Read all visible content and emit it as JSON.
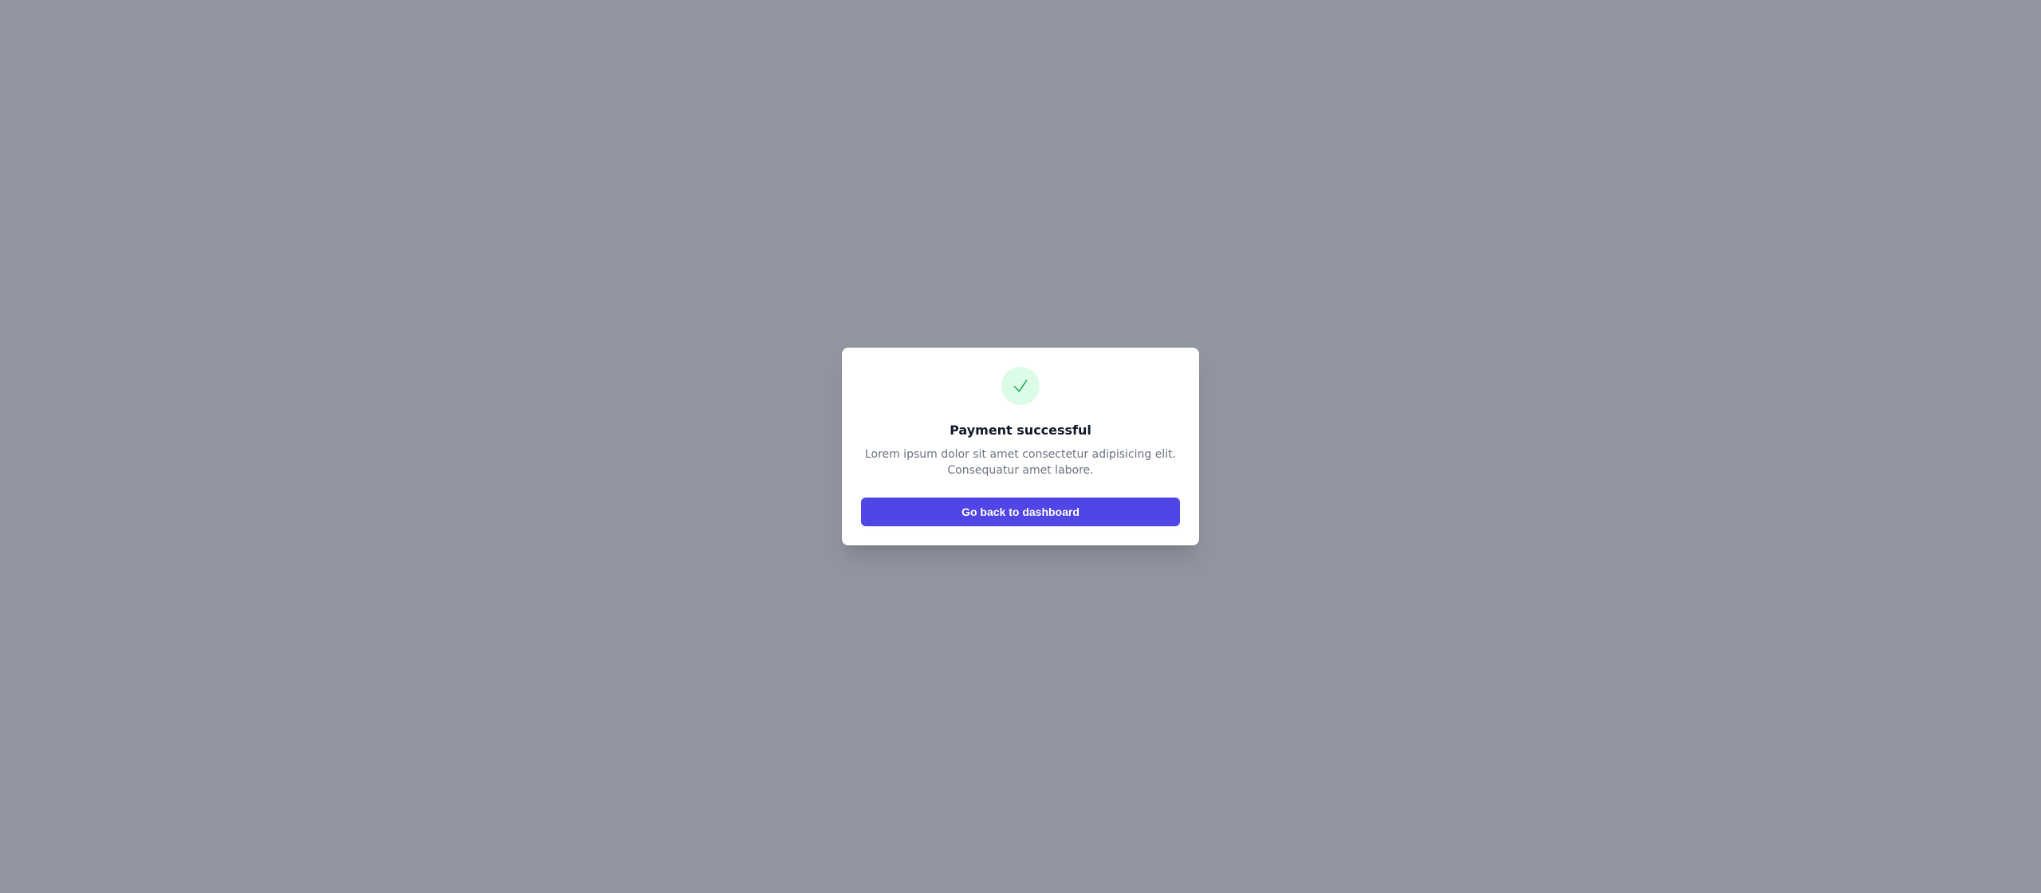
{
  "dialog": {
    "icon": "check-icon",
    "title": "Payment successful",
    "description": "Lorem ipsum dolor sit amet consectetur adipisicing elit. Consequatur amet labore.",
    "button_label": "Go back to dashboard"
  },
  "colors": {
    "backdrop": "#6b7280",
    "accent": "#4f46e5",
    "success_bg": "#dcfce7",
    "success_fg": "#16a34a"
  }
}
